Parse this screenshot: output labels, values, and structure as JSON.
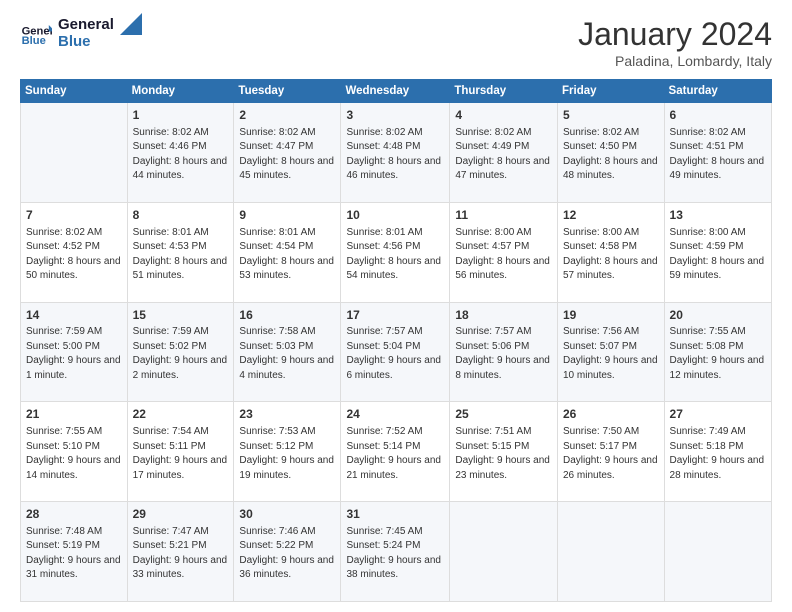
{
  "header": {
    "logo_general": "General",
    "logo_blue": "Blue",
    "month_title": "January 2024",
    "subtitle": "Paladina, Lombardy, Italy"
  },
  "weekdays": [
    "Sunday",
    "Monday",
    "Tuesday",
    "Wednesday",
    "Thursday",
    "Friday",
    "Saturday"
  ],
  "weeks": [
    [
      {
        "day": "",
        "sunrise": "",
        "sunset": "",
        "daylight": ""
      },
      {
        "day": "1",
        "sunrise": "Sunrise: 8:02 AM",
        "sunset": "Sunset: 4:46 PM",
        "daylight": "Daylight: 8 hours and 44 minutes."
      },
      {
        "day": "2",
        "sunrise": "Sunrise: 8:02 AM",
        "sunset": "Sunset: 4:47 PM",
        "daylight": "Daylight: 8 hours and 45 minutes."
      },
      {
        "day": "3",
        "sunrise": "Sunrise: 8:02 AM",
        "sunset": "Sunset: 4:48 PM",
        "daylight": "Daylight: 8 hours and 46 minutes."
      },
      {
        "day": "4",
        "sunrise": "Sunrise: 8:02 AM",
        "sunset": "Sunset: 4:49 PM",
        "daylight": "Daylight: 8 hours and 47 minutes."
      },
      {
        "day": "5",
        "sunrise": "Sunrise: 8:02 AM",
        "sunset": "Sunset: 4:50 PM",
        "daylight": "Daylight: 8 hours and 48 minutes."
      },
      {
        "day": "6",
        "sunrise": "Sunrise: 8:02 AM",
        "sunset": "Sunset: 4:51 PM",
        "daylight": "Daylight: 8 hours and 49 minutes."
      }
    ],
    [
      {
        "day": "7",
        "sunrise": "Sunrise: 8:02 AM",
        "sunset": "Sunset: 4:52 PM",
        "daylight": "Daylight: 8 hours and 50 minutes."
      },
      {
        "day": "8",
        "sunrise": "Sunrise: 8:01 AM",
        "sunset": "Sunset: 4:53 PM",
        "daylight": "Daylight: 8 hours and 51 minutes."
      },
      {
        "day": "9",
        "sunrise": "Sunrise: 8:01 AM",
        "sunset": "Sunset: 4:54 PM",
        "daylight": "Daylight: 8 hours and 53 minutes."
      },
      {
        "day": "10",
        "sunrise": "Sunrise: 8:01 AM",
        "sunset": "Sunset: 4:56 PM",
        "daylight": "Daylight: 8 hours and 54 minutes."
      },
      {
        "day": "11",
        "sunrise": "Sunrise: 8:00 AM",
        "sunset": "Sunset: 4:57 PM",
        "daylight": "Daylight: 8 hours and 56 minutes."
      },
      {
        "day": "12",
        "sunrise": "Sunrise: 8:00 AM",
        "sunset": "Sunset: 4:58 PM",
        "daylight": "Daylight: 8 hours and 57 minutes."
      },
      {
        "day": "13",
        "sunrise": "Sunrise: 8:00 AM",
        "sunset": "Sunset: 4:59 PM",
        "daylight": "Daylight: 8 hours and 59 minutes."
      }
    ],
    [
      {
        "day": "14",
        "sunrise": "Sunrise: 7:59 AM",
        "sunset": "Sunset: 5:00 PM",
        "daylight": "Daylight: 9 hours and 1 minute."
      },
      {
        "day": "15",
        "sunrise": "Sunrise: 7:59 AM",
        "sunset": "Sunset: 5:02 PM",
        "daylight": "Daylight: 9 hours and 2 minutes."
      },
      {
        "day": "16",
        "sunrise": "Sunrise: 7:58 AM",
        "sunset": "Sunset: 5:03 PM",
        "daylight": "Daylight: 9 hours and 4 minutes."
      },
      {
        "day": "17",
        "sunrise": "Sunrise: 7:57 AM",
        "sunset": "Sunset: 5:04 PM",
        "daylight": "Daylight: 9 hours and 6 minutes."
      },
      {
        "day": "18",
        "sunrise": "Sunrise: 7:57 AM",
        "sunset": "Sunset: 5:06 PM",
        "daylight": "Daylight: 9 hours and 8 minutes."
      },
      {
        "day": "19",
        "sunrise": "Sunrise: 7:56 AM",
        "sunset": "Sunset: 5:07 PM",
        "daylight": "Daylight: 9 hours and 10 minutes."
      },
      {
        "day": "20",
        "sunrise": "Sunrise: 7:55 AM",
        "sunset": "Sunset: 5:08 PM",
        "daylight": "Daylight: 9 hours and 12 minutes."
      }
    ],
    [
      {
        "day": "21",
        "sunrise": "Sunrise: 7:55 AM",
        "sunset": "Sunset: 5:10 PM",
        "daylight": "Daylight: 9 hours and 14 minutes."
      },
      {
        "day": "22",
        "sunrise": "Sunrise: 7:54 AM",
        "sunset": "Sunset: 5:11 PM",
        "daylight": "Daylight: 9 hours and 17 minutes."
      },
      {
        "day": "23",
        "sunrise": "Sunrise: 7:53 AM",
        "sunset": "Sunset: 5:12 PM",
        "daylight": "Daylight: 9 hours and 19 minutes."
      },
      {
        "day": "24",
        "sunrise": "Sunrise: 7:52 AM",
        "sunset": "Sunset: 5:14 PM",
        "daylight": "Daylight: 9 hours and 21 minutes."
      },
      {
        "day": "25",
        "sunrise": "Sunrise: 7:51 AM",
        "sunset": "Sunset: 5:15 PM",
        "daylight": "Daylight: 9 hours and 23 minutes."
      },
      {
        "day": "26",
        "sunrise": "Sunrise: 7:50 AM",
        "sunset": "Sunset: 5:17 PM",
        "daylight": "Daylight: 9 hours and 26 minutes."
      },
      {
        "day": "27",
        "sunrise": "Sunrise: 7:49 AM",
        "sunset": "Sunset: 5:18 PM",
        "daylight": "Daylight: 9 hours and 28 minutes."
      }
    ],
    [
      {
        "day": "28",
        "sunrise": "Sunrise: 7:48 AM",
        "sunset": "Sunset: 5:19 PM",
        "daylight": "Daylight: 9 hours and 31 minutes."
      },
      {
        "day": "29",
        "sunrise": "Sunrise: 7:47 AM",
        "sunset": "Sunset: 5:21 PM",
        "daylight": "Daylight: 9 hours and 33 minutes."
      },
      {
        "day": "30",
        "sunrise": "Sunrise: 7:46 AM",
        "sunset": "Sunset: 5:22 PM",
        "daylight": "Daylight: 9 hours and 36 minutes."
      },
      {
        "day": "31",
        "sunrise": "Sunrise: 7:45 AM",
        "sunset": "Sunset: 5:24 PM",
        "daylight": "Daylight: 9 hours and 38 minutes."
      },
      {
        "day": "",
        "sunrise": "",
        "sunset": "",
        "daylight": ""
      },
      {
        "day": "",
        "sunrise": "",
        "sunset": "",
        "daylight": ""
      },
      {
        "day": "",
        "sunrise": "",
        "sunset": "",
        "daylight": ""
      }
    ]
  ]
}
